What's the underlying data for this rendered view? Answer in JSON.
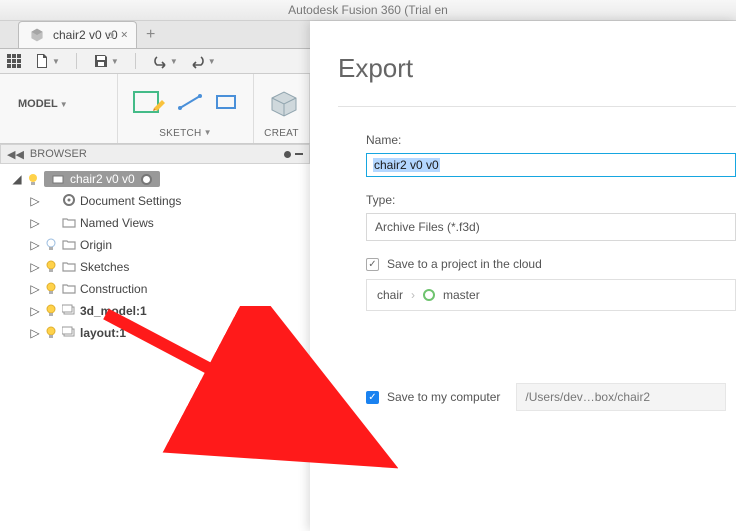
{
  "titlebar": "Autodesk Fusion 360 (Trial en",
  "tab": {
    "label": "chair2 v0 v0"
  },
  "ribbon": {
    "model": "MODEL",
    "sketch": "SKETCH",
    "create": "CREAT"
  },
  "browser": {
    "header": "BROWSER",
    "root": "chair2 v0 v0",
    "items": [
      {
        "label": "Document Settings",
        "icon": "gear",
        "lit": false,
        "show_bulb": false
      },
      {
        "label": "Named Views",
        "icon": "folder",
        "lit": false,
        "show_bulb": false
      },
      {
        "label": "Origin",
        "icon": "folder",
        "lit": false,
        "show_bulb": true
      },
      {
        "label": "Sketches",
        "icon": "folder",
        "lit": true,
        "show_bulb": true
      },
      {
        "label": "Construction",
        "icon": "folder",
        "lit": true,
        "show_bulb": true
      },
      {
        "label": "3d_model:1",
        "icon": "component",
        "lit": true,
        "show_bulb": true
      },
      {
        "label": "layout:1",
        "icon": "component",
        "lit": true,
        "show_bulb": true
      }
    ]
  },
  "dialog": {
    "title": "Export",
    "name_label": "Name:",
    "name_value": "chair2 v0 v0",
    "type_label": "Type:",
    "type_value": "Archive Files (*.f3d)",
    "save_cloud_label": "Save to a project in the cloud",
    "crumb_project": "chair",
    "crumb_branch": "master",
    "save_local_label": "Save to my computer",
    "local_path": "/Users/dev…box/chair2"
  }
}
